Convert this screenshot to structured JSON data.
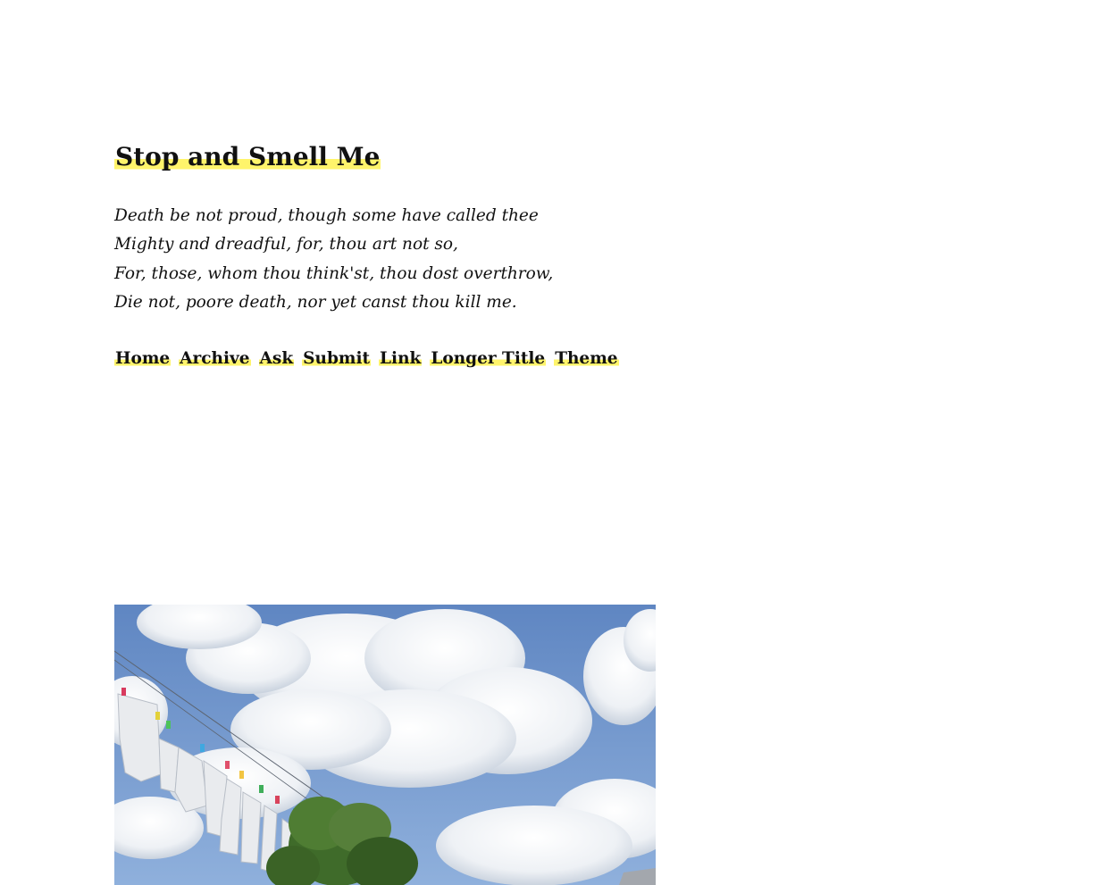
{
  "blog": {
    "title": "Stop and Smell Me",
    "description_lines": [
      "Death be not proud, though some have called thee",
      "Mighty and dreadful, for, thou art not so,",
      "For, those, whom thou think'st, thou dost overthrow,",
      "Die not, poore death, nor yet canst thou kill me."
    ]
  },
  "nav": {
    "items": [
      {
        "label": "Home"
      },
      {
        "label": "Archive"
      },
      {
        "label": "Ask"
      },
      {
        "label": "Submit"
      },
      {
        "label": "Link"
      },
      {
        "label": "Longer Title"
      },
      {
        "label": "Theme"
      }
    ]
  },
  "post": {
    "photo_subject": "clothesline-under-cloudy-sky"
  },
  "colors": {
    "highlight": "#fff46b",
    "text": "#111111",
    "background": "#ffffff",
    "sky": "#6f93c8"
  }
}
